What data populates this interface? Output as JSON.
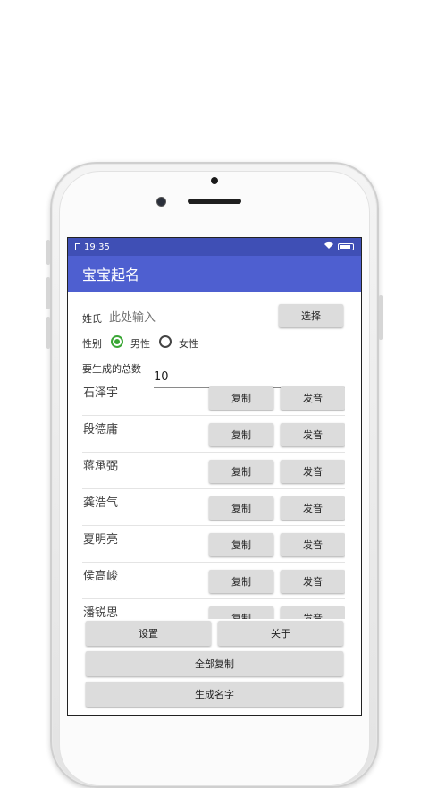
{
  "status": {
    "time": "19:35"
  },
  "app": {
    "title": "宝宝起名"
  },
  "form": {
    "surname_label": "姓氏",
    "surname_placeholder": "此处输入",
    "choose_button": "选择",
    "gender_label": "性别",
    "gender_male": "男性",
    "gender_female": "女性",
    "gender_selected": "男性",
    "count_label": "要生成的总数",
    "count_value": "10"
  },
  "names": [
    {
      "name": "石泽宇",
      "copy": "复制",
      "speak": "发音"
    },
    {
      "name": "段德庸",
      "copy": "复制",
      "speak": "发音"
    },
    {
      "name": "蒋承弼",
      "copy": "复制",
      "speak": "发音"
    },
    {
      "name": "龚浩气",
      "copy": "复制",
      "speak": "发音"
    },
    {
      "name": "夏明亮",
      "copy": "复制",
      "speak": "发音"
    },
    {
      "name": "侯高峻",
      "copy": "复制",
      "speak": "发音"
    },
    {
      "name": "潘锐思",
      "copy": "复制",
      "speak": "发音"
    }
  ],
  "actions": {
    "settings": "设置",
    "about": "关于",
    "copy_all": "全部复制",
    "generate": "生成名字"
  },
  "colors": {
    "primary": "#4e5fd0",
    "primary_dark": "#3f4fb5",
    "accent": "#3aa635"
  }
}
